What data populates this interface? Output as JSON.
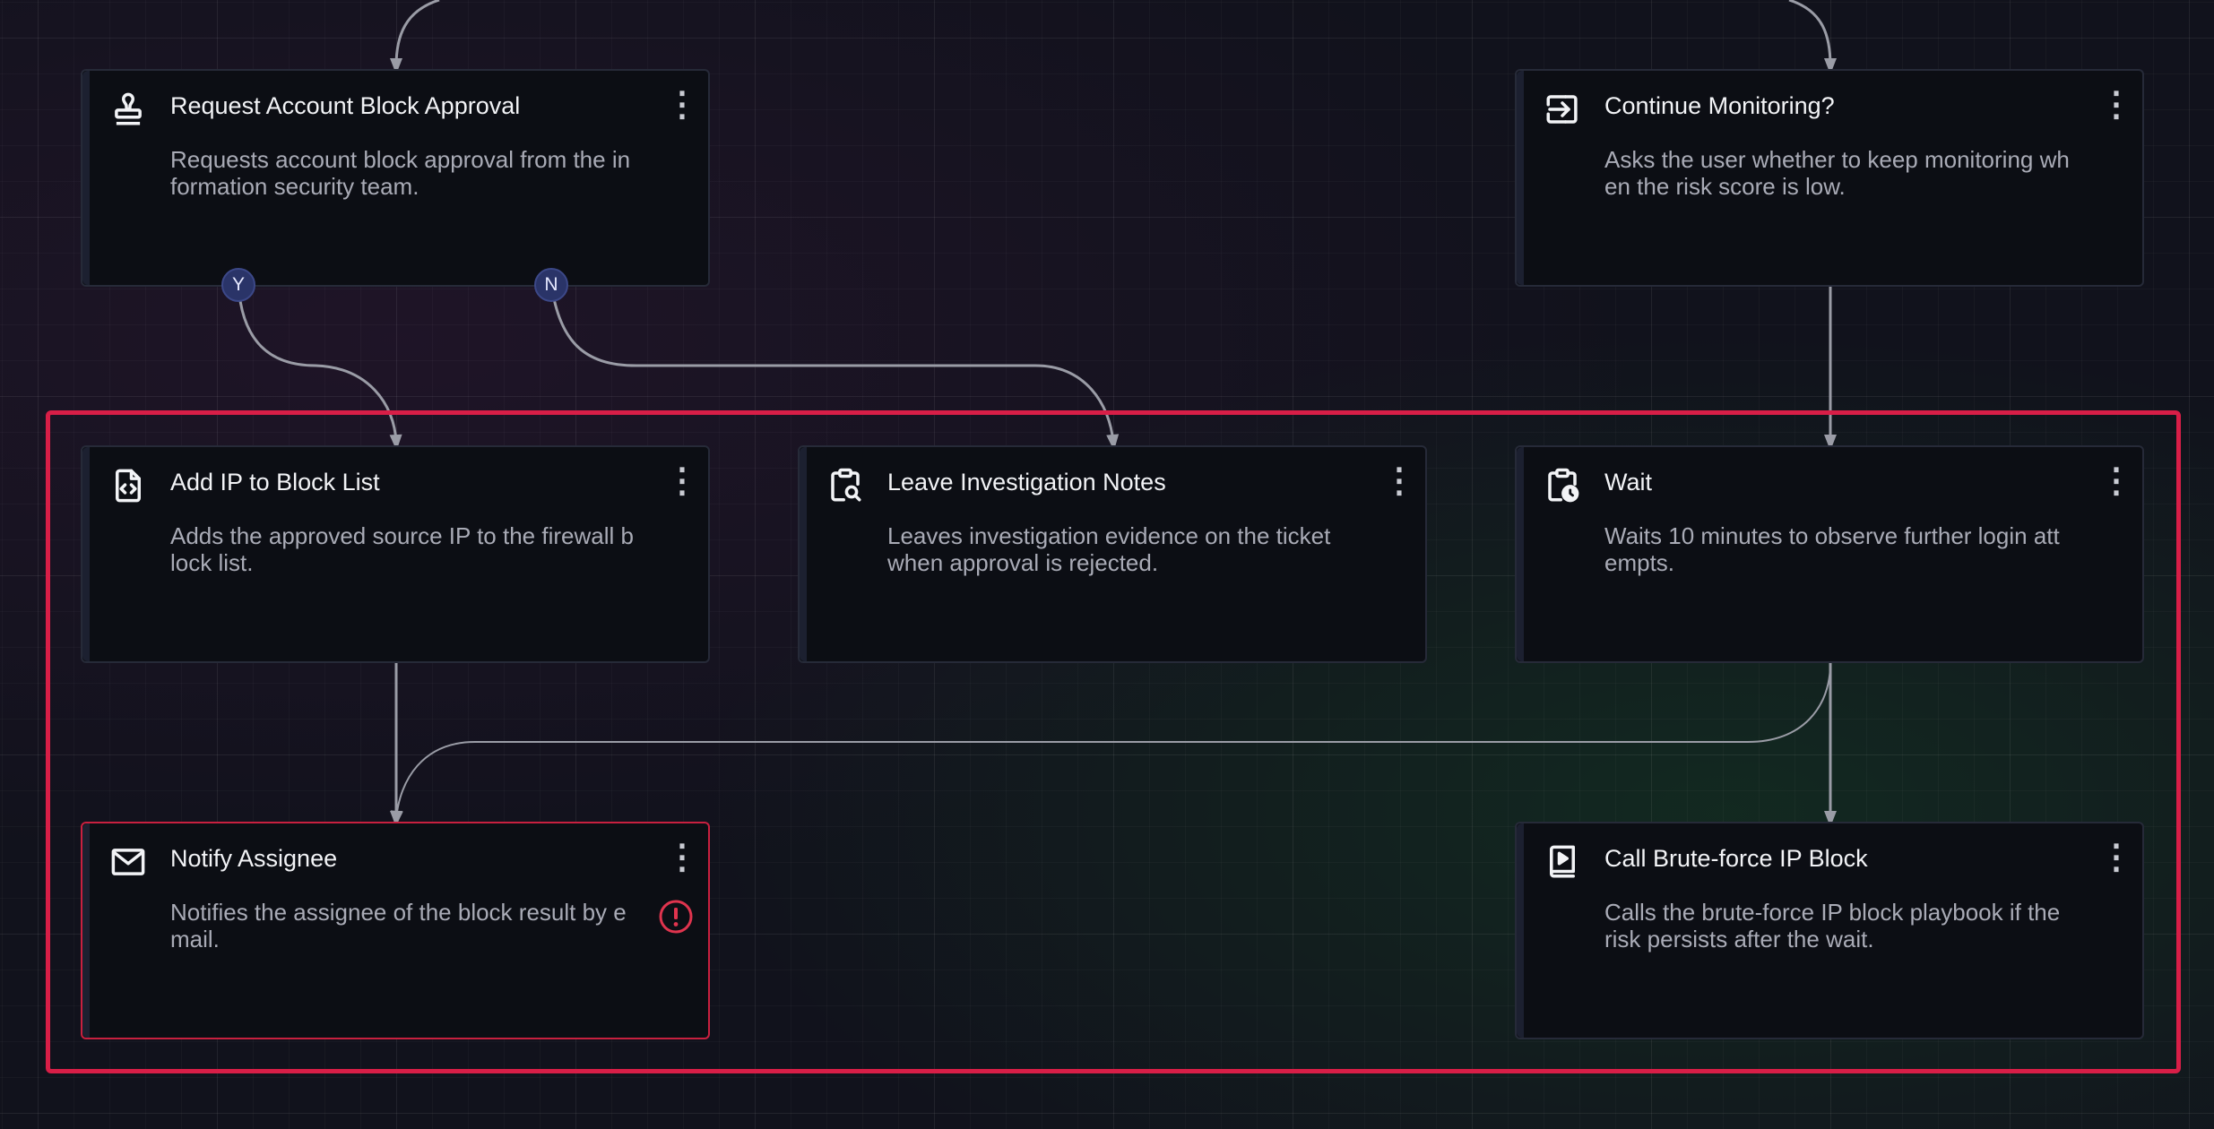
{
  "nodes": {
    "request_block": {
      "title": "Request Account Block Approval",
      "description": "Requests account block approval from the information security team.",
      "icon": "stamp-icon"
    },
    "continue_monitoring": {
      "title": "Continue Monitoring?",
      "description": "Asks the user whether to keep monitoring when the risk score is low.",
      "icon": "arrow-into-box-icon"
    },
    "add_ip": {
      "title": "Add IP to Block List",
      "description": "Adds the approved source IP to the firewall block list.",
      "icon": "code-file-icon"
    },
    "leave_notes": {
      "title": "Leave Investigation Notes",
      "description": "Leaves investigation evidence on the ticket when approval is rejected.",
      "icon": "clipboard-search-icon"
    },
    "wait": {
      "title": "Wait",
      "description": "Waits 10 minutes to observe further login attempts.",
      "icon": "clipboard-clock-icon"
    },
    "notify": {
      "title": "Notify Assignee",
      "description": "Notifies the assignee of the block result by email.",
      "icon": "envelope-icon",
      "status": "error"
    },
    "call_playbook": {
      "title": "Call Brute-force IP Block",
      "description": "Calls the brute-force IP block playbook if the risk persists after the wait.",
      "icon": "playbook-icon"
    }
  },
  "ports": {
    "yes": "Y",
    "no": "N"
  },
  "menu_glyph": "⋮",
  "colors": {
    "selection": "#d81e47",
    "port": "#2a3468",
    "edge": "#9a9ca6",
    "error": "#e0344e"
  }
}
